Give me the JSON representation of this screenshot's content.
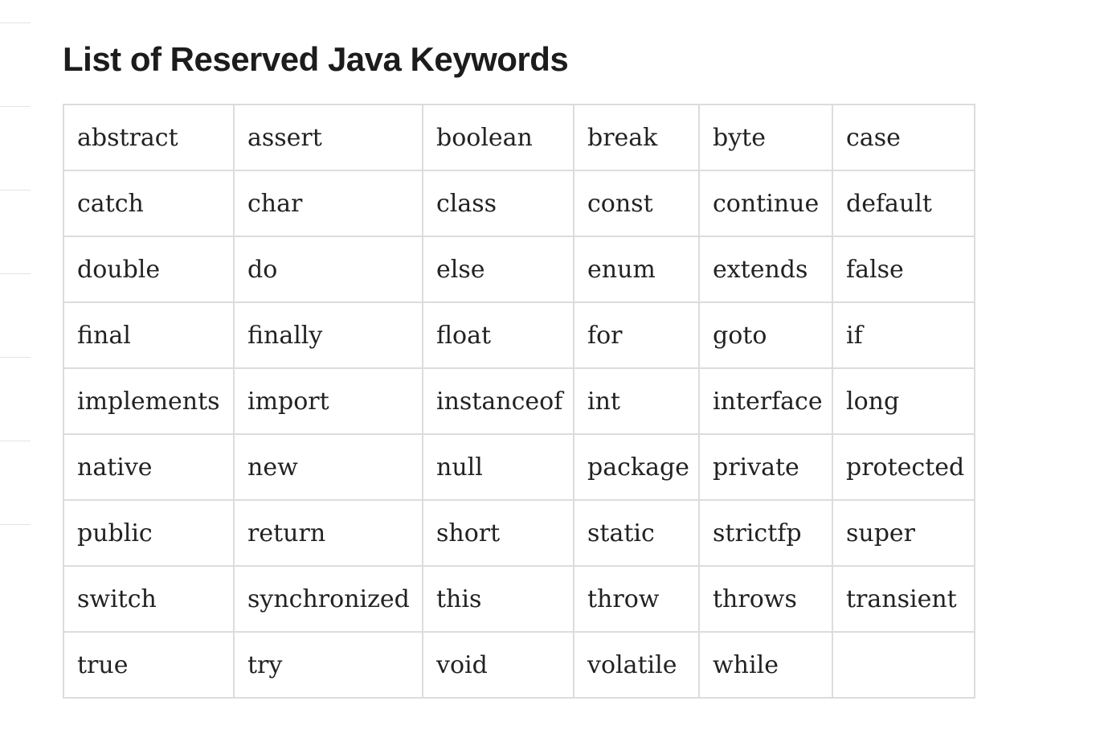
{
  "title": "List of Reserved Java Keywords",
  "highlight_color": "#d8d49a",
  "rows": [
    [
      "abstract",
      "assert",
      "boolean",
      "break",
      "byte",
      "case"
    ],
    [
      "catch",
      "char",
      "class",
      "const",
      "continue",
      "default"
    ],
    [
      "double",
      "do",
      "else",
      "enum",
      "extends",
      "false"
    ],
    [
      "final",
      "finally",
      "float",
      "for",
      "goto",
      "if"
    ],
    [
      "implements",
      "import",
      "instanceof",
      "int",
      "interface",
      "long"
    ],
    [
      "native",
      "new",
      "null",
      "package",
      "private",
      "protected"
    ],
    [
      "public",
      "return",
      "short",
      "static",
      "strictfp",
      "super"
    ],
    [
      "switch",
      "synchronized",
      "this",
      "throw",
      "throws",
      "transient"
    ],
    [
      "true",
      "try",
      "void",
      "volatile",
      "while",
      ""
    ]
  ]
}
